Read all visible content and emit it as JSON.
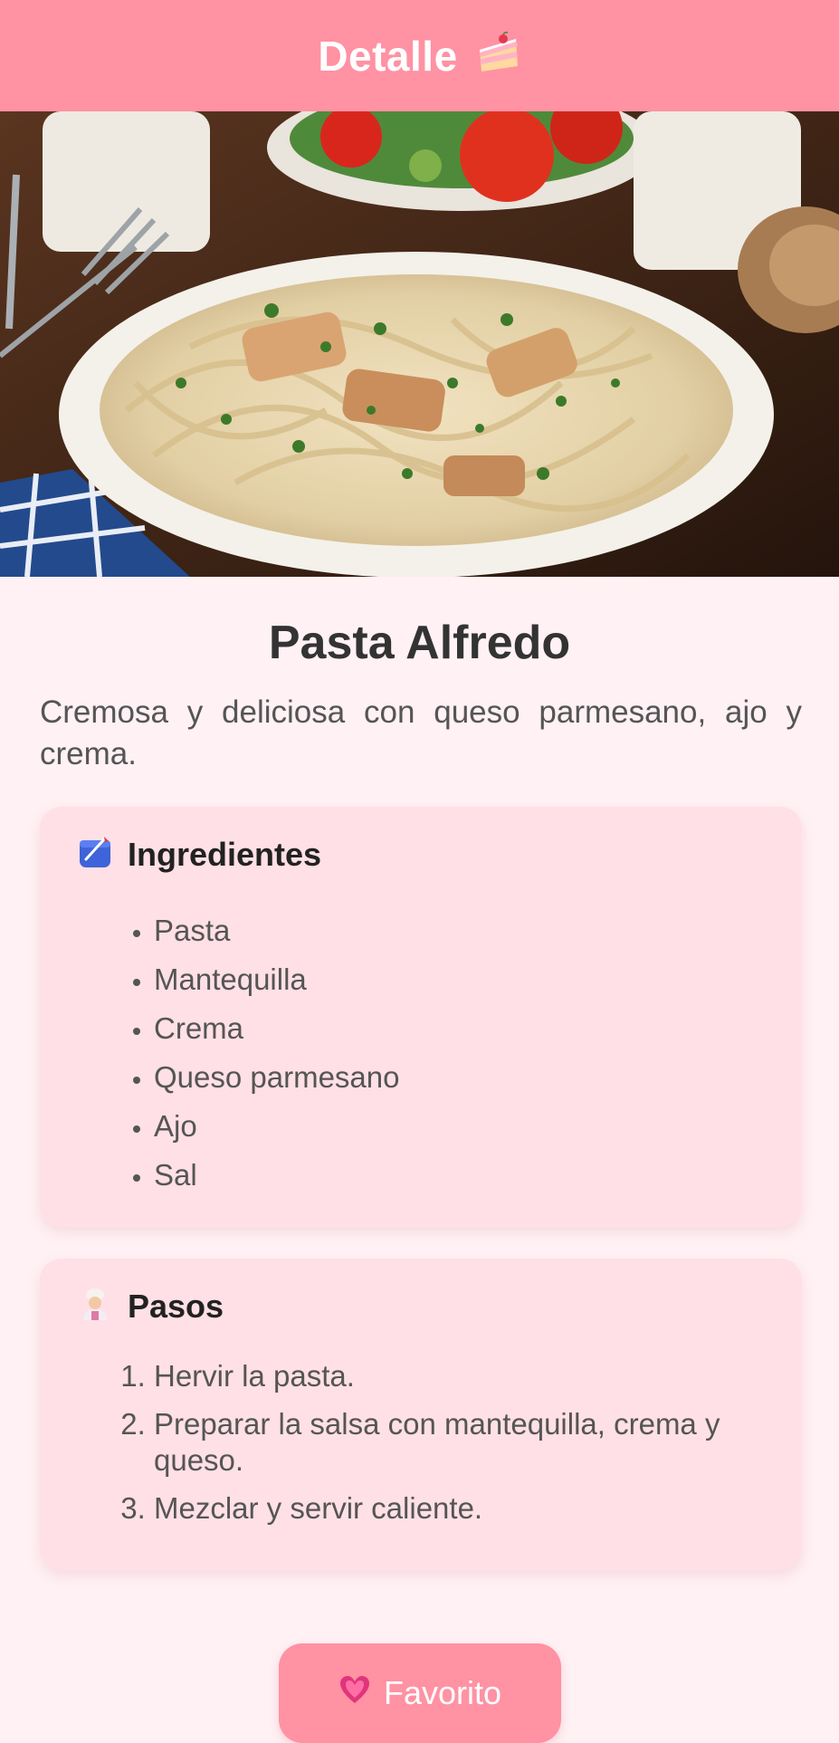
{
  "header": {
    "title": "Detalle",
    "title_icon": "cake-slice-icon",
    "background": "#ff92a3"
  },
  "hero_image": {
    "subject": "plate of fettuccine alfredo with chicken"
  },
  "recipe": {
    "title": "Pasta Alfredo",
    "description": "Cremosa y deliciosa con queso parmesano, ajo y crema."
  },
  "ingredients": {
    "icon": "blue-notebook-icon",
    "heading": "Ingredientes",
    "items": [
      "Pasta",
      "Mantequilla",
      "Crema",
      "Queso parmesano",
      "Ajo",
      "Sal"
    ]
  },
  "steps": {
    "icon": "cook-icon",
    "heading": "Pasos",
    "items": [
      "Hervir la pasta.",
      "Preparar la salsa con mantequilla, crema y queso.",
      "Mezclar y servir caliente."
    ]
  },
  "favorite_button": {
    "icon": "heart-icon",
    "label": "Favorito"
  },
  "colors": {
    "accent": "#ff92a3",
    "page_background": "#fff1f4",
    "card_background": "#ffe0e6",
    "text_dark": "#333333",
    "text_muted": "#555555"
  }
}
